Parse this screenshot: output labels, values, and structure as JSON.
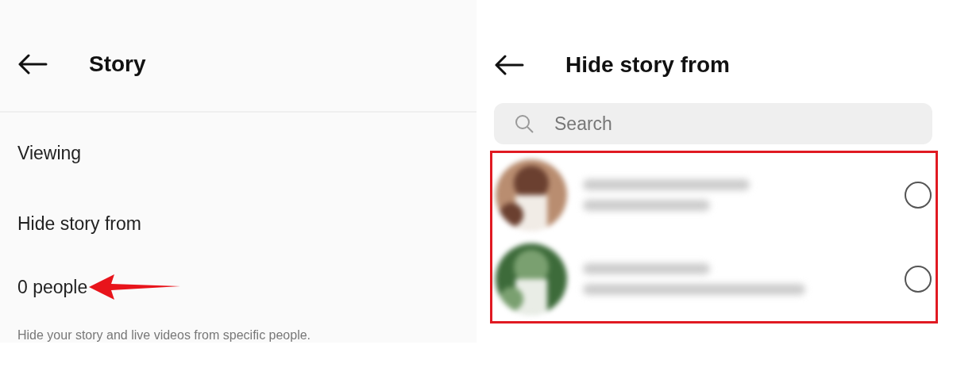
{
  "story_screen": {
    "title": "Story",
    "sections": [
      {
        "label": "Viewing"
      },
      {
        "label": "Hide story from"
      }
    ],
    "count": "0 people",
    "caption": "Hide your story and live videos from specific people."
  },
  "hide_screen": {
    "title": "Hide story from",
    "search": {
      "placeholder": "Search"
    },
    "people": [
      {
        "selected": false
      },
      {
        "selected": false
      }
    ]
  }
}
